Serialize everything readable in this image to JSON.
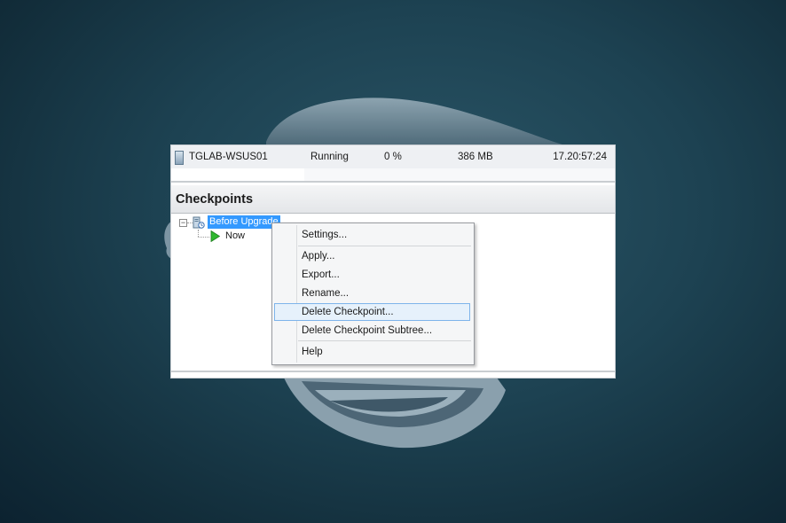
{
  "vm": {
    "name": "TGLAB-WSUS01",
    "state": "Running",
    "cpu": "0 %",
    "memory": "386 MB",
    "uptime": "17.20:57:24"
  },
  "checkpoints": {
    "title": "Checkpoints",
    "tree": {
      "snapshot_label": "Before Upgrade",
      "now_label": "Now"
    }
  },
  "context_menu": {
    "items": [
      {
        "label": "Settings..."
      },
      {
        "label": "Apply..."
      },
      {
        "label": "Export..."
      },
      {
        "label": "Rename..."
      },
      {
        "label": "Delete Checkpoint...",
        "highlighted": true
      },
      {
        "label": "Delete Checkpoint Subtree..."
      },
      {
        "label": "Help"
      }
    ]
  },
  "colors": {
    "selection": "#3399ff",
    "menu_highlight": "#e6f1fb",
    "now_arrow": "#2fb82f"
  },
  "icons": [
    "vm-icon",
    "checkpoint-icon",
    "now-arrow-icon",
    "collapse-icon"
  ]
}
